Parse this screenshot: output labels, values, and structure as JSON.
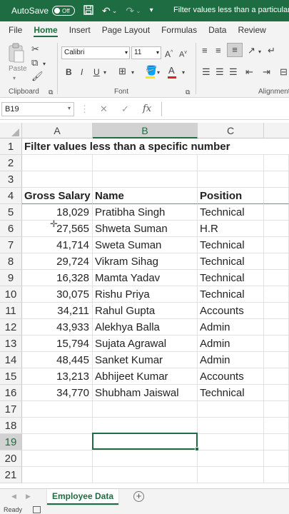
{
  "titlebar": {
    "autosave_label": "AutoSave",
    "autosave_state": "Off",
    "document_title": "Filter values less than a particular nu",
    "bg_color": "#1e6c41"
  },
  "ribbon_tabs": [
    "File",
    "Home",
    "Insert",
    "Page Layout",
    "Formulas",
    "Data",
    "Review"
  ],
  "active_tab": "Home",
  "ribbon": {
    "paste_label": "Paste",
    "clipboard_label": "Clipboard",
    "font_label": "Font",
    "alignment_label": "Alignment",
    "font_name": "Calibri",
    "font_size": "11",
    "bold": "B",
    "italic": "I",
    "underline": "U"
  },
  "formula_bar": {
    "name_box": "B19",
    "fx": "fx",
    "value": ""
  },
  "columns": [
    "A",
    "B",
    "C"
  ],
  "selected_column": "B",
  "rows": [
    {
      "num": "1",
      "a": "Filter values less than a specific number",
      "b": "",
      "c": "",
      "type": "title"
    },
    {
      "num": "2",
      "a": "",
      "b": "",
      "c": "",
      "type": "empty"
    },
    {
      "num": "3",
      "a": "",
      "b": "",
      "c": "",
      "type": "empty"
    },
    {
      "num": "4",
      "a": "Gross Salary",
      "b": "Name",
      "c": "Position",
      "type": "header"
    },
    {
      "num": "5",
      "a": "18,029",
      "b": "Pratibha Singh",
      "c": "Technical",
      "type": "data"
    },
    {
      "num": "6",
      "a": "27,565",
      "b": "Shweta Suman",
      "c": "H.R",
      "type": "data"
    },
    {
      "num": "7",
      "a": "41,714",
      "b": "Sweta Suman",
      "c": "Technical",
      "type": "data"
    },
    {
      "num": "8",
      "a": "29,724",
      "b": "Vikram Sihag",
      "c": "Technical",
      "type": "data"
    },
    {
      "num": "9",
      "a": "16,328",
      "b": "Mamta Yadav",
      "c": "Technical",
      "type": "data"
    },
    {
      "num": "10",
      "a": "30,075",
      "b": "Rishu Priya",
      "c": "Technical",
      "type": "data"
    },
    {
      "num": "11",
      "a": "34,211",
      "b": "Rahul Gupta",
      "c": "Accounts",
      "type": "data"
    },
    {
      "num": "12",
      "a": "43,933",
      "b": "Alekhya Balla",
      "c": "Admin",
      "type": "data"
    },
    {
      "num": "13",
      "a": "15,794",
      "b": "Sujata Agrawal",
      "c": "Admin",
      "type": "data"
    },
    {
      "num": "14",
      "a": "48,445",
      "b": "Sanket Kumar",
      "c": "Admin",
      "type": "data"
    },
    {
      "num": "15",
      "a": "13,213",
      "b": "Abhijeet Kumar",
      "c": "Accounts",
      "type": "data"
    },
    {
      "num": "16",
      "a": "34,770",
      "b": "Shubham Jaiswal",
      "c": "Technical",
      "type": "data"
    },
    {
      "num": "17",
      "a": "",
      "b": "",
      "c": "",
      "type": "empty"
    },
    {
      "num": "18",
      "a": "",
      "b": "",
      "c": "",
      "type": "empty"
    },
    {
      "num": "19",
      "a": "",
      "b": "",
      "c": "",
      "type": "empty"
    },
    {
      "num": "20",
      "a": "",
      "b": "",
      "c": "",
      "type": "empty"
    },
    {
      "num": "21",
      "a": "",
      "b": "",
      "c": "",
      "type": "empty"
    }
  ],
  "selected_row": "19",
  "sheet_tabs": [
    "Employee Data"
  ],
  "status": "Ready",
  "accent_color": "#1e6c41"
}
